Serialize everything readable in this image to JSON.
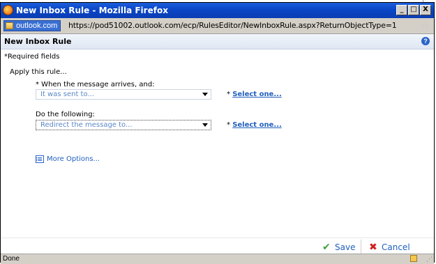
{
  "window": {
    "title": "New Inbox Rule - Mozilla Firefox",
    "controls": {
      "minimize": "_",
      "maximize": "□",
      "close": "X"
    }
  },
  "urlbar": {
    "site": "outlook.com",
    "url": "https://pod51002.outlook.com/ecp/RulesEditor/NewInboxRule.aspx?ReturnObjectType=1",
    "bookmark_icon": "star-icon"
  },
  "page": {
    "title": "New Inbox Rule",
    "help": "?",
    "required_note": "*Required fields",
    "apply_text": "Apply this rule..."
  },
  "condition": {
    "label": "* When the message arrives, and:",
    "value": "It was sent to...",
    "required": "*",
    "link": "Select one..."
  },
  "action": {
    "label": "Do the following:",
    "value": "Redirect the message to...",
    "required": "*",
    "link": "Select one..."
  },
  "more_options": "More Options...",
  "buttons": {
    "save": "Save",
    "cancel": "Cancel",
    "save_icon": "check-icon",
    "cancel_icon": "x-icon"
  },
  "status": {
    "text": "Done"
  },
  "colors": {
    "titlebar": "#0a46c6",
    "link": "#1f5fbf",
    "save_check": "#3ea23e",
    "cancel_x": "#d11e1e"
  }
}
